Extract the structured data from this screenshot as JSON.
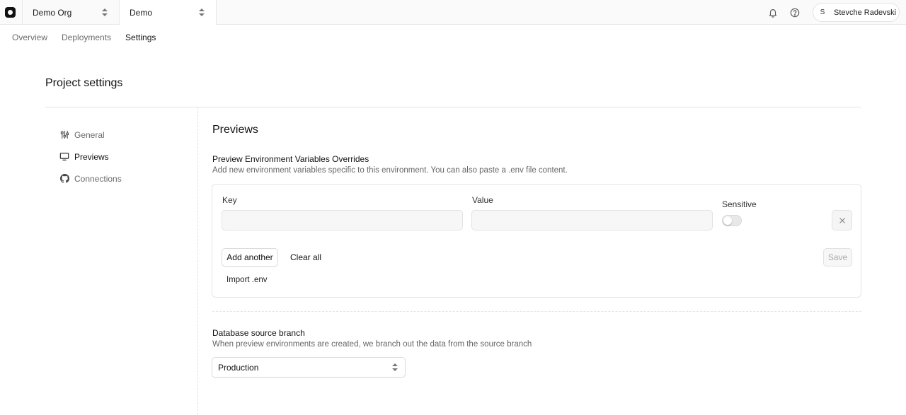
{
  "topbar": {
    "org_name": "Demo Org",
    "project_name": "Demo",
    "user_initial": "S",
    "user_name": "Stevche Radevski"
  },
  "tabs": [
    {
      "label": "Overview"
    },
    {
      "label": "Deployments"
    },
    {
      "label": "Settings"
    }
  ],
  "page": {
    "title": "Project settings"
  },
  "sidenav": {
    "items": [
      {
        "label": "General",
        "icon": "sliders-icon"
      },
      {
        "label": "Previews",
        "icon": "monitor-icon"
      },
      {
        "label": "Connections",
        "icon": "github-icon"
      }
    ]
  },
  "previews": {
    "title": "Previews",
    "overrides_heading": "Preview Environment Variables Overrides",
    "overrides_description": "Add new environment variables specific to this environment. You can also paste a .env file content.",
    "key_label": "Key",
    "value_label": "Value",
    "sensitive_label": "Sensitive",
    "key_value": "",
    "value_value": "",
    "add_another": "Add another",
    "clear_all": "Clear all",
    "save": "Save",
    "import_env": "Import .env",
    "branch_heading": "Database source branch",
    "branch_description": "When preview environments are created, we branch out the data from the source branch",
    "branch_selected": "Production"
  }
}
